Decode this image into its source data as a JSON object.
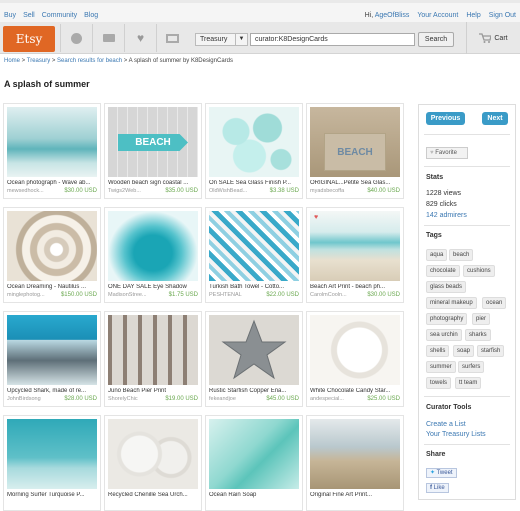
{
  "topnav": {
    "left": [
      "Buy",
      "Sell",
      "Community",
      "Blog"
    ],
    "greeting": "Hi,",
    "user": "AgeOfBliss",
    "right": [
      "Your Account",
      "Help",
      "Sign Out"
    ]
  },
  "header": {
    "logo": "Etsy",
    "search_scope": "Treasury",
    "search_value": "curator:K8DesignCards",
    "search_button": "Search",
    "cart_label": "Cart"
  },
  "breadcrumb": {
    "items": [
      "Home",
      "Treasury",
      "Search results for beach"
    ],
    "sep": " > ",
    "current": "A splash of summer by K8DesignCards"
  },
  "page_title": "A splash of summer",
  "items": [
    {
      "caption": "Ocean photograph - Wave ab...",
      "shop": "mewsedhock...",
      "price": "$30.00 USD"
    },
    {
      "caption": "Wooden beach sign coastal ...",
      "shop": "Twigs2Web...",
      "price": "$35.00 USD"
    },
    {
      "caption": "On SALE Sea Glass Finish P...",
      "shop": "OldWishBead...",
      "price": "$3.38 USD"
    },
    {
      "caption": "ORIGINAL...Petite Sea Glas...",
      "shop": "myadsbecoffa",
      "price": "$40.00 USD"
    },
    {
      "caption": "Ocean Dreaming - Nautilus ...",
      "shop": "minglephotog...",
      "price": "$150.00 USD"
    },
    {
      "caption": "ONE DAY SALE Eye Shadow",
      "shop": "MadisonStree...",
      "price": "$1.75 USD"
    },
    {
      "caption": "Turkish Bath Towel - Cotto...",
      "shop": "PESHTENAL",
      "price": "$22.00 USD"
    },
    {
      "caption": "Beach Art Print - beach ph...",
      "shop": "CarolmCooln...",
      "price": "$30.00 USD"
    },
    {
      "caption": "Upcycled Shark, made of re...",
      "shop": "JohnBirdsong",
      "price": "$28.00 USD"
    },
    {
      "caption": "Juno Beach Pier Print",
      "shop": "ShorelyChic",
      "price": "$19.00 USD"
    },
    {
      "caption": "Rustic Starfish Copper Ena...",
      "shop": "fekeandjoe",
      "price": "$45.00 USD"
    },
    {
      "caption": "White Chocolate Candy Star...",
      "shop": "andespecial...",
      "price": "$25.00 USD"
    },
    {
      "caption": "Morning Surfer Turquoise P...",
      "shop": "",
      "price": ""
    },
    {
      "caption": "Recycled Chenille Sea Urch...",
      "shop": "",
      "price": ""
    },
    {
      "caption": "Ocean Rain Soap",
      "shop": "",
      "price": ""
    },
    {
      "caption": "Original Fine Art Print...",
      "shop": "",
      "price": ""
    }
  ],
  "sidebar": {
    "previous": "Previous",
    "next": "Next",
    "favorite": "Favorite",
    "stats_title": "Stats",
    "views": "1228 views",
    "clicks": "829 clicks",
    "admirers": "142 admirers",
    "tags_title": "Tags",
    "tags": [
      "aqua",
      "beach",
      "chocolate",
      "cushions",
      "glass beads",
      "mineral makeup",
      "ocean",
      "photography",
      "pier",
      "sea urchin",
      "sharks",
      "shells",
      "soap",
      "starfish",
      "summer",
      "surfers",
      "towels",
      "tt team"
    ],
    "curator_title": "Curator Tools",
    "create_list": "Create a List",
    "your_lists": "Your Treasury Lists",
    "share_title": "Share",
    "tweet": "Tweet",
    "like": "Like"
  },
  "colors": {
    "brand": "#e06724",
    "link": "#3b78b2",
    "button": "#3a9bc7",
    "price": "#6aa84f"
  }
}
